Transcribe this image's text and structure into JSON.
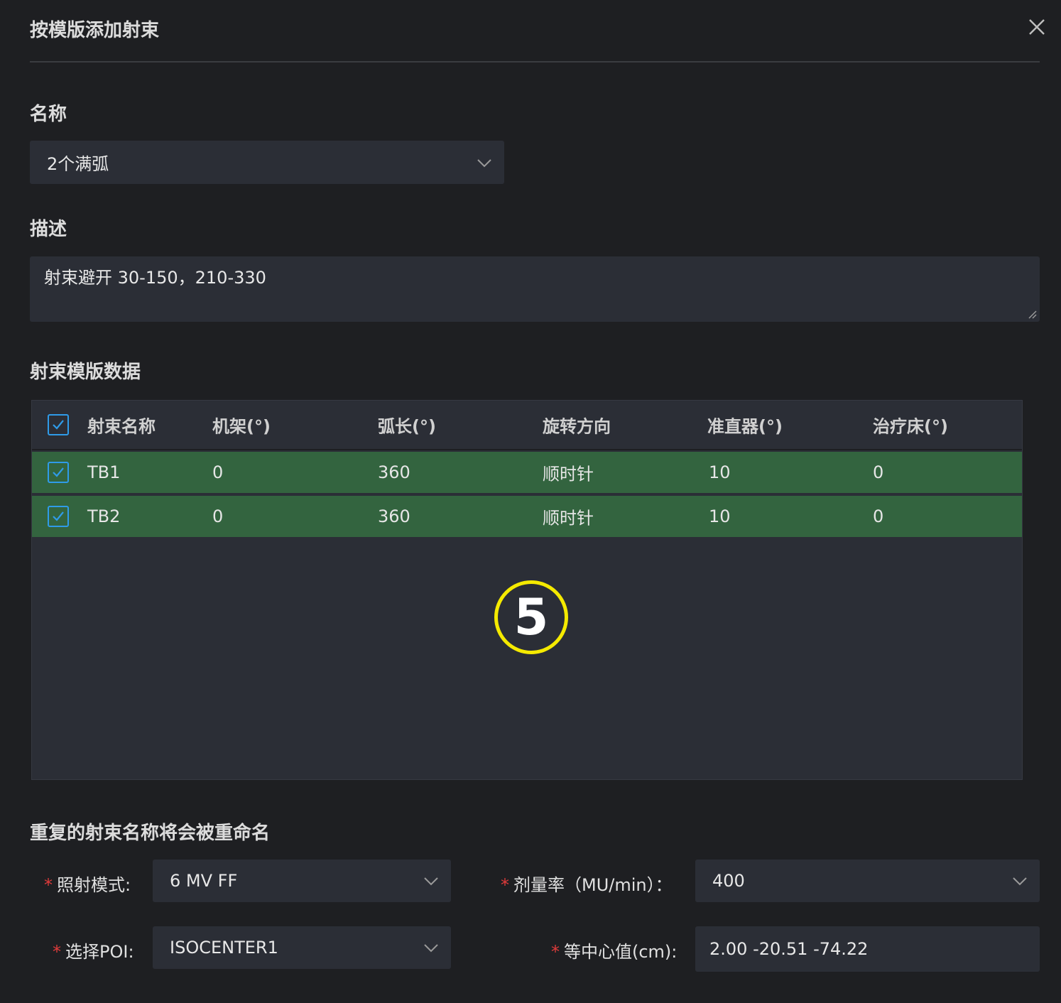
{
  "dialog": {
    "title": "按模版添加射束",
    "close_icon": "close-icon"
  },
  "name_field": {
    "label": "名称",
    "value": "2个满弧"
  },
  "description_field": {
    "label": "描述",
    "value": "射束避开 30-150，210-330"
  },
  "beam_table": {
    "section_title": "射束模版数据",
    "all_checked": true,
    "columns": [
      "射束名称",
      "机架(°)",
      "弧长(°)",
      "旋转方向",
      "准直器(°)",
      "治疗床(°)"
    ],
    "rows": [
      {
        "checked": true,
        "cells": [
          "TB1",
          "0",
          "360",
          "顺时针",
          "10",
          "0"
        ]
      },
      {
        "checked": true,
        "cells": [
          "TB2",
          "0",
          "360",
          "顺时针",
          "10",
          "0"
        ]
      }
    ],
    "selected_row_color": "#33643f"
  },
  "annotation_marker": "5",
  "rename_notice": "重复的射束名称将会被重命名",
  "form": {
    "required_mark": "*",
    "irradiation_mode": {
      "label": "照射模式:",
      "value": "6 MV FF"
    },
    "dose_rate": {
      "label": "剂量率（MU/min）：",
      "value": "400"
    },
    "poi": {
      "label": "选择POI:",
      "value": "ISOCENTER1"
    },
    "isocenter": {
      "label": "等中心值(cm):",
      "value": "2.00 -20.51 -74.22"
    }
  },
  "colors": {
    "background": "#1e1f22",
    "field_bg": "#2b2e36",
    "checkbox_accent": "#2f9be8",
    "required_red": "#e03b3b",
    "marker_yellow": "#f5ea00"
  }
}
